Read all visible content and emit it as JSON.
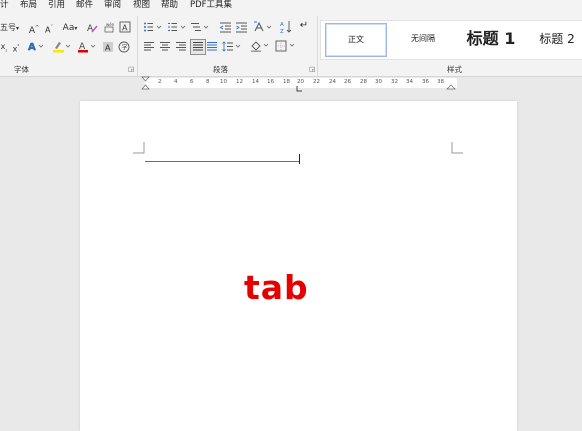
{
  "menu": [
    "计",
    "布局",
    "引用",
    "邮件",
    "审阅",
    "视图",
    "帮助",
    "PDF工具集"
  ],
  "font": {
    "size_value": "五号",
    "grow": "A",
    "shrink": "A",
    "case_label": "Aa",
    "group_label": "字体"
  },
  "paragraph": {
    "group_label": "段落"
  },
  "styles": {
    "group_label": "样式",
    "items": [
      "正文",
      "无间隔",
      "标题 1",
      "标题 2"
    ]
  },
  "ruler": {
    "ticks": [
      "2",
      "4",
      "6",
      "8",
      "10",
      "12",
      "14",
      "16",
      "18",
      "20",
      "22",
      "24",
      "26",
      "28",
      "30",
      "32",
      "34",
      "36",
      "38"
    ]
  },
  "document": {
    "text": "tab",
    "text_color": "#e60000"
  },
  "colors": {
    "highlight": "#ffe600",
    "font_color": "#e00000",
    "accent": "#2f6fcf"
  }
}
